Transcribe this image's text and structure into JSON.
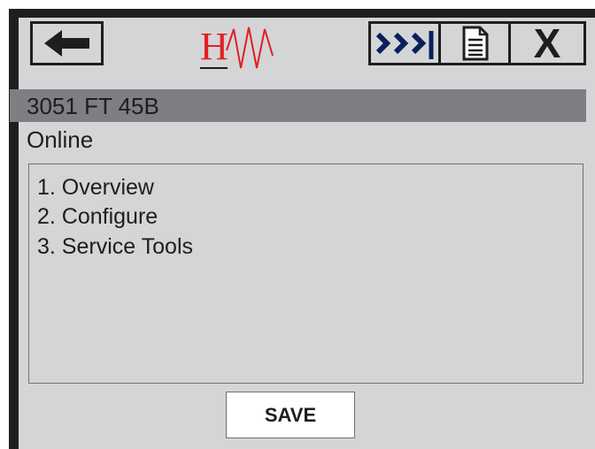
{
  "toolbar": {
    "back_icon": "left-arrow-icon",
    "next_icon": "triple-chevron-icon",
    "document_icon": "document-icon",
    "close_label": "X"
  },
  "logo": {
    "letter": "H"
  },
  "header": {
    "title": "3051 FT 45B",
    "status": "Online"
  },
  "menu": {
    "items": [
      {
        "label": "1. Overview"
      },
      {
        "label": "2. Configure"
      },
      {
        "label": "3. Service Tools"
      }
    ]
  },
  "footer": {
    "save_label": "SAVE"
  },
  "colors": {
    "frame": "#1e1e1e",
    "screen": "#d3d5d6",
    "title_bar": "#7d7f82",
    "logo_red": "#e31e24",
    "chevron_navy": "#0b1f5c"
  }
}
